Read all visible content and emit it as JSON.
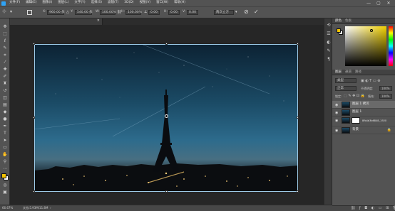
{
  "menu": [
    "文件(F)",
    "编辑(E)",
    "图像(I)",
    "图层(L)",
    "文字(Y)",
    "选择(S)",
    "滤镜(T)",
    "3D(D)",
    "视图(V)",
    "窗口(W)",
    "帮助(H)"
  ],
  "window_controls": [
    "—",
    "▢",
    "✕"
  ],
  "options": {
    "x_label": "X:",
    "x_value": "960.00 像",
    "y_label": "Y:",
    "y_value": "540.00 像",
    "w_label": "W:",
    "w_value": "100.00%",
    "h_label": "H:",
    "h_value": "100.00%",
    "angle_value": "0.00",
    "hskew_label": "H:",
    "hskew_value": "0.00",
    "vskew_label": "V:",
    "vskew_value": "0.00",
    "interp_value": "两次立方",
    "cancel_icon": "cancel-icon",
    "commit_icon": "commit-icon"
  },
  "document_tab": {
    "title": "paris 1245970_1920.jpg @ 66.7% (图层 1 拷贝, RGB/8#) *",
    "close": "×"
  },
  "statusbar": {
    "zoom": "66.67%",
    "doc_info": "文档:5.93M/11.8M"
  },
  "color_panel": {
    "tab1": "颜色",
    "tab2": "色板"
  },
  "layers_panel": {
    "tab1": "图层",
    "tab2": "通道",
    "tab3": "路径",
    "kind_label": "类型",
    "blend_mode": "正常",
    "opacity_label": "不透明度:",
    "opacity_value": "100%",
    "lock_label": "锁定:",
    "fill_label": "填充:",
    "fill_value": "100%",
    "layers": [
      {
        "name": "图层 1 拷贝",
        "visible": true,
        "selected": true
      },
      {
        "name": "图层 1",
        "visible": true,
        "selected": false
      },
      {
        "name": "8fb4b3b6848_1920",
        "visible": true,
        "selected": false
      },
      {
        "name": "背景",
        "visible": true,
        "selected": false
      }
    ],
    "footer_icons": [
      "link-icon",
      "fx-icon",
      "mask-icon",
      "adjust-icon",
      "folder-icon",
      "new-layer-icon",
      "trash-icon"
    ]
  },
  "colors": {
    "foreground": "#f5c400",
    "background": "#ffffff",
    "hue_accent": "#f0d000"
  }
}
